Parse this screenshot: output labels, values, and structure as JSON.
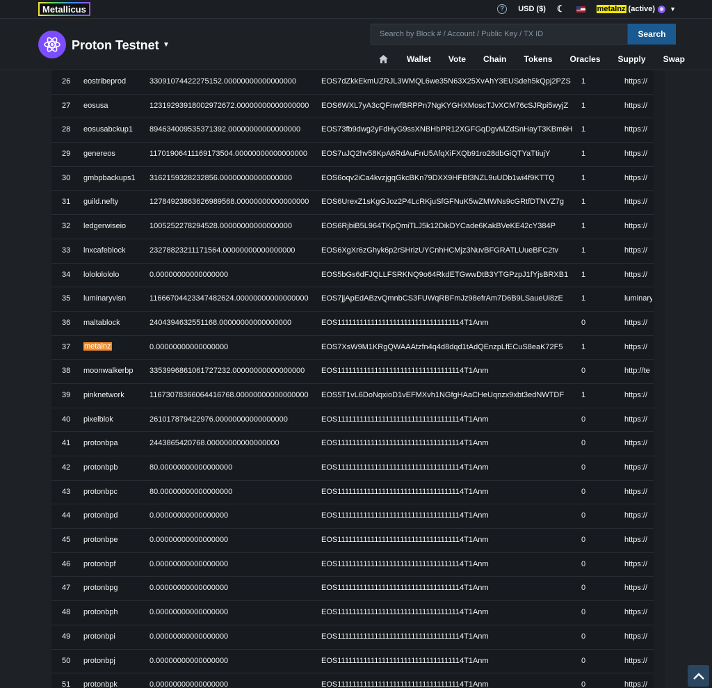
{
  "topbar": {
    "logo": "Metallicus",
    "currency": "USD ($)",
    "account_name": "metalnz",
    "account_status": "(active)"
  },
  "header": {
    "network_name": "Proton Testnet",
    "search_placeholder": "Search by Block # / Account / Public Key / TX ID",
    "search_button": "Search",
    "nav": [
      "Wallet",
      "Vote",
      "Chain",
      "Tokens",
      "Oracles",
      "Supply",
      "Swap"
    ]
  },
  "producers": [
    {
      "rank": "26",
      "owner": "eostribeprod",
      "votes": "33091074422275152.00000000000000000",
      "key": "EOS7dZkkEkmUZRJL3WMQL6we35N63X25XvAhY3EUSdeh5kQpj2PZS",
      "active": "1",
      "url": "https://"
    },
    {
      "rank": "27",
      "owner": "eosusa",
      "votes": "12319293918002972672.00000000000000000",
      "key": "EOS6WXL7yA3cQFnwfBRPPn7NgKYGHXMoscTJvXCM76cSJRpi5wyjZ",
      "active": "1",
      "url": "https://"
    },
    {
      "rank": "28",
      "owner": "eosusabckup1",
      "votes": "894634009535371392.00000000000000000",
      "key": "EOS73fb9dwg2yFdHyG9ssXNBHbPR12XGFGqDgvMZdSnHayT3KBm6H",
      "active": "1",
      "url": "https://"
    },
    {
      "rank": "29",
      "owner": "genereos",
      "votes": "11701906411169173504.00000000000000000",
      "key": "EOS7uJQ2hv58KpA6RdAuFnU5AfqXiFXQb91ro28dbGiQTYaTtiujY",
      "active": "1",
      "url": "https://"
    },
    {
      "rank": "30",
      "owner": "gmbpbackups1",
      "votes": "3162159328232856.00000000000000000",
      "key": "EOS6oqv2iCa4kvzjgqGkcBKn79DXX9HFBf3NZL9uUDb1wi4f9KTTQ",
      "active": "1",
      "url": "https://"
    },
    {
      "rank": "31",
      "owner": "guild.nefty",
      "votes": "12784923863626989568.00000000000000000",
      "key": "EOS6UrexZ1sKgGJoz2P4LcRKjuSfGFNuK5wZMWNs9cGRtfDTNVZ7g",
      "active": "1",
      "url": "https://"
    },
    {
      "rank": "32",
      "owner": "ledgerwiseio",
      "votes": "1005252278294528.00000000000000000",
      "key": "EOS6RjbiB5L964TKpQmiTLJ5k12DikDYCade6KakBVeKE42cY384P",
      "active": "1",
      "url": "https://"
    },
    {
      "rank": "33",
      "owner": "lnxcafeblock",
      "votes": "23278823211171564.00000000000000000",
      "key": "EOS6XgXr6zGhyk6p2rSHrizUYCnhHCMjz3NuvBFGRATLUueBFC2tv",
      "active": "1",
      "url": "https://"
    },
    {
      "rank": "34",
      "owner": "lolololololo",
      "votes": "0.00000000000000000",
      "key": "EOS5bGs6dFJQLLFSRKNQ9o64RkdETGwwDtB3YTGPzpJ1fYjsBRXB1",
      "active": "1",
      "url": "https://"
    },
    {
      "rank": "35",
      "owner": "luminaryvisn",
      "votes": "11666704423347482624.00000000000000000",
      "key": "EOS7jjApEdABzvQmnbCS3FUWqRBFmJz98efrAm7D6B9LSaueUi8zE",
      "active": "1",
      "url": "luminary"
    },
    {
      "rank": "36",
      "owner": "maltablock",
      "votes": "2404394632551168.00000000000000000",
      "key": "EOS1111111111111111111111111111111114T1Anm",
      "active": "0",
      "url": "https://"
    },
    {
      "rank": "37",
      "owner": "metalnz",
      "votes": "0.00000000000000000",
      "key": "EOS7XsW9M1KRgQWAAAtzfn4q4d8dqd1tAdQEnzpLfECuS8eaK72F5",
      "active": "1",
      "url": "https://",
      "highlight": true
    },
    {
      "rank": "38",
      "owner": "moonwalkerbp",
      "votes": "3353996861061727232.00000000000000000",
      "key": "EOS1111111111111111111111111111111114T1Anm",
      "active": "0",
      "url": "http://te"
    },
    {
      "rank": "39",
      "owner": "pinknetwork",
      "votes": "11673078366064416768.00000000000000000",
      "key": "EOS5T1vL6DoNqxioD1vEFMXvh1NGfgHAaCHeUqnzx9xbt3edNWTDF",
      "active": "1",
      "url": "https://"
    },
    {
      "rank": "40",
      "owner": "pixelblok",
      "votes": "261017879422976.00000000000000000",
      "key": "EOS1111111111111111111111111111111114T1Anm",
      "active": "0",
      "url": "https://"
    },
    {
      "rank": "41",
      "owner": "protonbpa",
      "votes": "2443865420768.00000000000000000",
      "key": "EOS1111111111111111111111111111111114T1Anm",
      "active": "0",
      "url": "https://"
    },
    {
      "rank": "42",
      "owner": "protonbpb",
      "votes": "80.00000000000000000",
      "key": "EOS1111111111111111111111111111111114T1Anm",
      "active": "0",
      "url": "https://"
    },
    {
      "rank": "43",
      "owner": "protonbpc",
      "votes": "80.00000000000000000",
      "key": "EOS1111111111111111111111111111111114T1Anm",
      "active": "0",
      "url": "https://"
    },
    {
      "rank": "44",
      "owner": "protonbpd",
      "votes": "0.00000000000000000",
      "key": "EOS1111111111111111111111111111111114T1Anm",
      "active": "0",
      "url": "https://"
    },
    {
      "rank": "45",
      "owner": "protonbpe",
      "votes": "0.00000000000000000",
      "key": "EOS1111111111111111111111111111111114T1Anm",
      "active": "0",
      "url": "https://"
    },
    {
      "rank": "46",
      "owner": "protonbpf",
      "votes": "0.00000000000000000",
      "key": "EOS1111111111111111111111111111111114T1Anm",
      "active": "0",
      "url": "https://"
    },
    {
      "rank": "47",
      "owner": "protonbpg",
      "votes": "0.00000000000000000",
      "key": "EOS1111111111111111111111111111111114T1Anm",
      "active": "0",
      "url": "https://"
    },
    {
      "rank": "48",
      "owner": "protonbph",
      "votes": "0.00000000000000000",
      "key": "EOS1111111111111111111111111111111114T1Anm",
      "active": "0",
      "url": "https://"
    },
    {
      "rank": "49",
      "owner": "protonbpi",
      "votes": "0.00000000000000000",
      "key": "EOS1111111111111111111111111111111114T1Anm",
      "active": "0",
      "url": "https://"
    },
    {
      "rank": "50",
      "owner": "protonbpj",
      "votes": "0.00000000000000000",
      "key": "EOS1111111111111111111111111111111114T1Anm",
      "active": "0",
      "url": "https://"
    },
    {
      "rank": "51",
      "owner": "protonbpk",
      "votes": "0.00000000000000000",
      "key": "EOS1111111111111111111111111111111114T1Anm",
      "active": "0",
      "url": "https://"
    }
  ],
  "icons": {
    "help": "help-circle-icon",
    "theme": "moon-icon",
    "flag": "us-flag-icon",
    "home": "home-icon",
    "scroll_top": "chevron-up-icon"
  },
  "colors": {
    "accent_blue": "#1a5a90",
    "proton_purple": "#7c4dff",
    "highlight_yellow": "#f2e800",
    "highlight_orange": "#f18a27"
  }
}
